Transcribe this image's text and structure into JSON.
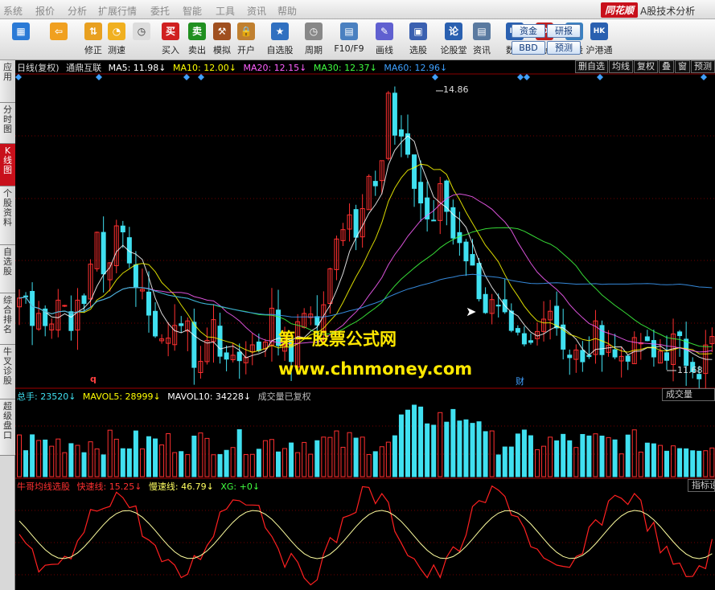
{
  "menu": {
    "items": [
      "系统",
      "报价",
      "分析",
      "扩展行情",
      "委托",
      "智能",
      "工具",
      "资讯",
      "帮助"
    ],
    "brand": "同花顺",
    "title": "A股技术分析"
  },
  "toolbar": {
    "buttons": [
      {
        "label": "",
        "icon": "windows-grid-icon",
        "color": "#2a7ad6"
      },
      {
        "label": "",
        "icon": "back-arrow-icon",
        "color": "#f0a020"
      },
      {
        "label": "修正",
        "icon": "up-down-arrows-icon",
        "color": "#e8a020"
      },
      {
        "label": "测速",
        "icon": "speed-icon",
        "color": "#f0b020"
      },
      {
        "label": "",
        "icon": "clock-icon",
        "color": "#ddd"
      },
      {
        "label": "买入",
        "icon": "buy-icon",
        "color": "#d02020"
      },
      {
        "label": "卖出",
        "icon": "sell-icon",
        "color": "#209020"
      },
      {
        "label": "模拟",
        "icon": "hammer-icon",
        "color": "#a05020"
      },
      {
        "label": "开户",
        "icon": "lock-icon",
        "color": "#c08030"
      },
      {
        "label": "自选股",
        "icon": "star-icon",
        "color": "#3070c0"
      },
      {
        "label": "周期",
        "icon": "cycle-clock-icon",
        "color": "#888"
      },
      {
        "label": "F10/F9",
        "icon": "f10-icon",
        "color": "#4a80c0"
      },
      {
        "label": "画线",
        "icon": "pencil-icon",
        "color": "#6060d0"
      },
      {
        "label": "选股",
        "icon": "select-stock-icon",
        "color": "#3a60b0"
      },
      {
        "label": "论股堂",
        "icon": "forum-icon",
        "color": "#2a60b0"
      },
      {
        "label": "资讯",
        "icon": "news-icon",
        "color": "#5a7aa0"
      },
      {
        "label": "数据",
        "icon": "pe-icon",
        "color": "#2a60b0"
      },
      {
        "label": "热点",
        "icon": "hot-icon",
        "color": "#c02020"
      },
      {
        "label": "新股",
        "icon": "ipo-icon",
        "color": "#3a80c0"
      },
      {
        "label": "沪港通",
        "icon": "hk-connect-icon",
        "color": "#2a60b0"
      }
    ],
    "small": [
      "资金",
      "研报",
      "BBD",
      "预测"
    ]
  },
  "tabs": [
    {
      "label": "应用"
    },
    {
      "label": "分时图"
    },
    {
      "label": "K线图",
      "active": true
    },
    {
      "label": "个股资料"
    },
    {
      "label": "自选股"
    },
    {
      "label": "综合排名"
    },
    {
      "label": "牛叉诊股"
    },
    {
      "label": "超级盘口"
    }
  ],
  "info": {
    "period": "日线(复权)",
    "stock": "通鼎互联",
    "ma5": "MA5: 11.98↓",
    "ma10": "MA10: 12.00↓",
    "ma20": "MA20: 12.15↓",
    "ma30": "MA30: 12.37↓",
    "ma60": "MA60: 12.96↓",
    "buttons": [
      "删自选",
      "均线",
      "复权",
      "叠",
      "窗",
      "预测"
    ]
  },
  "colors": {
    "ma5": "#ffffff",
    "ma10": "#ffff00",
    "ma20": "#ff60ff",
    "ma30": "#40ff40",
    "ma60": "#3ea0ff",
    "up": "#ff3030",
    "down": "#40e0f0"
  },
  "price": {
    "high": "14.86",
    "low": "11.68",
    "marker_q": "q",
    "marker_cai": "财"
  },
  "volume": {
    "total": "总手: 23520↓",
    "mavol5": "MAVOL5: 28999↓",
    "mavol10": "MAVOL10: 34228↓",
    "note": "成交量已复权",
    "button": "成交量"
  },
  "indicator": {
    "name": "牛哥均线选股",
    "fast": "快速线: 15.25↓",
    "slow": "慢速线: 46.79↓",
    "xg": "XG: +0↓",
    "button": "指标设"
  },
  "watermark": {
    "line1": "第一股票公式网",
    "line2": "www.chnmoney.com"
  }
}
